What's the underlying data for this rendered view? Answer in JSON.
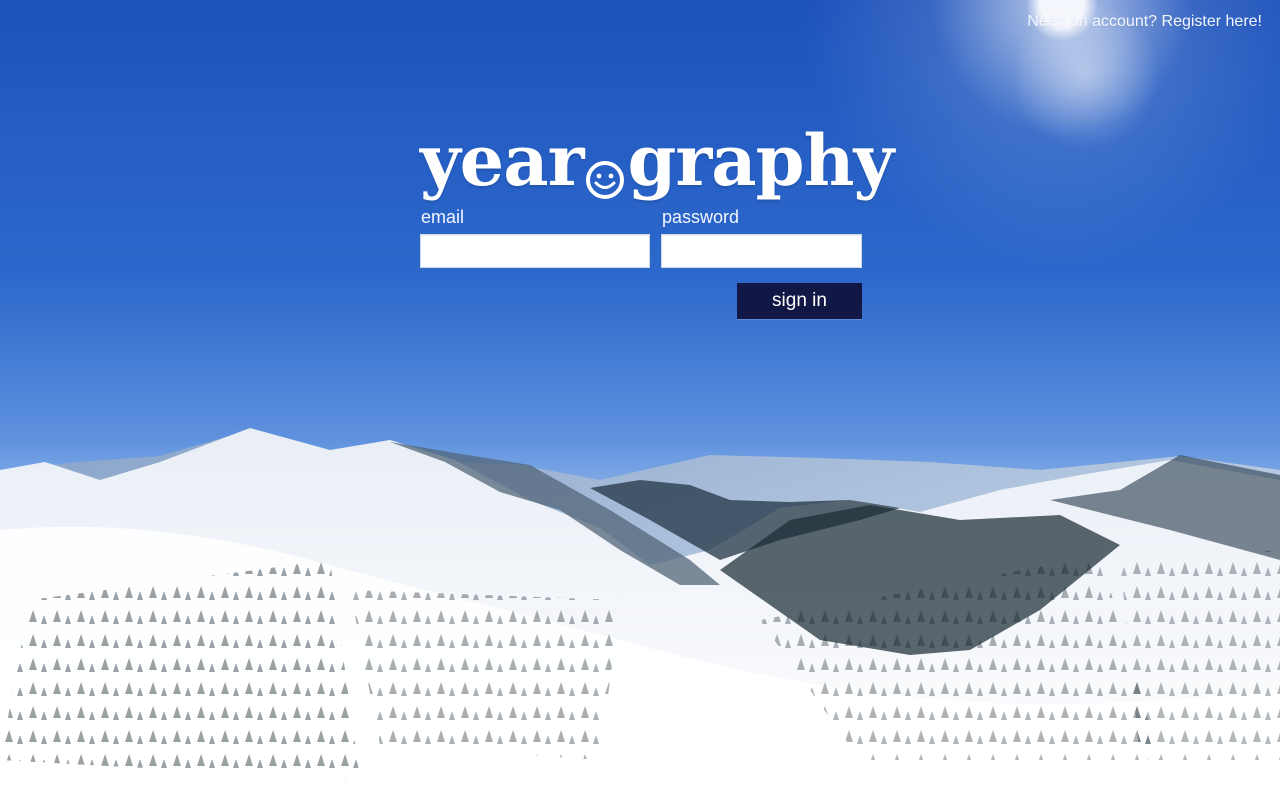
{
  "header": {
    "register_link": "Need an account? Register here!"
  },
  "brand": {
    "before_icon": "year",
    "icon": "smiley-face-icon",
    "after_icon": "graphy"
  },
  "login": {
    "email_label": "email",
    "email_value": "",
    "password_label": "password",
    "password_value": "",
    "sign_in_label": "sign in"
  },
  "colors": {
    "button": "#111845",
    "text": "#ffffff"
  }
}
